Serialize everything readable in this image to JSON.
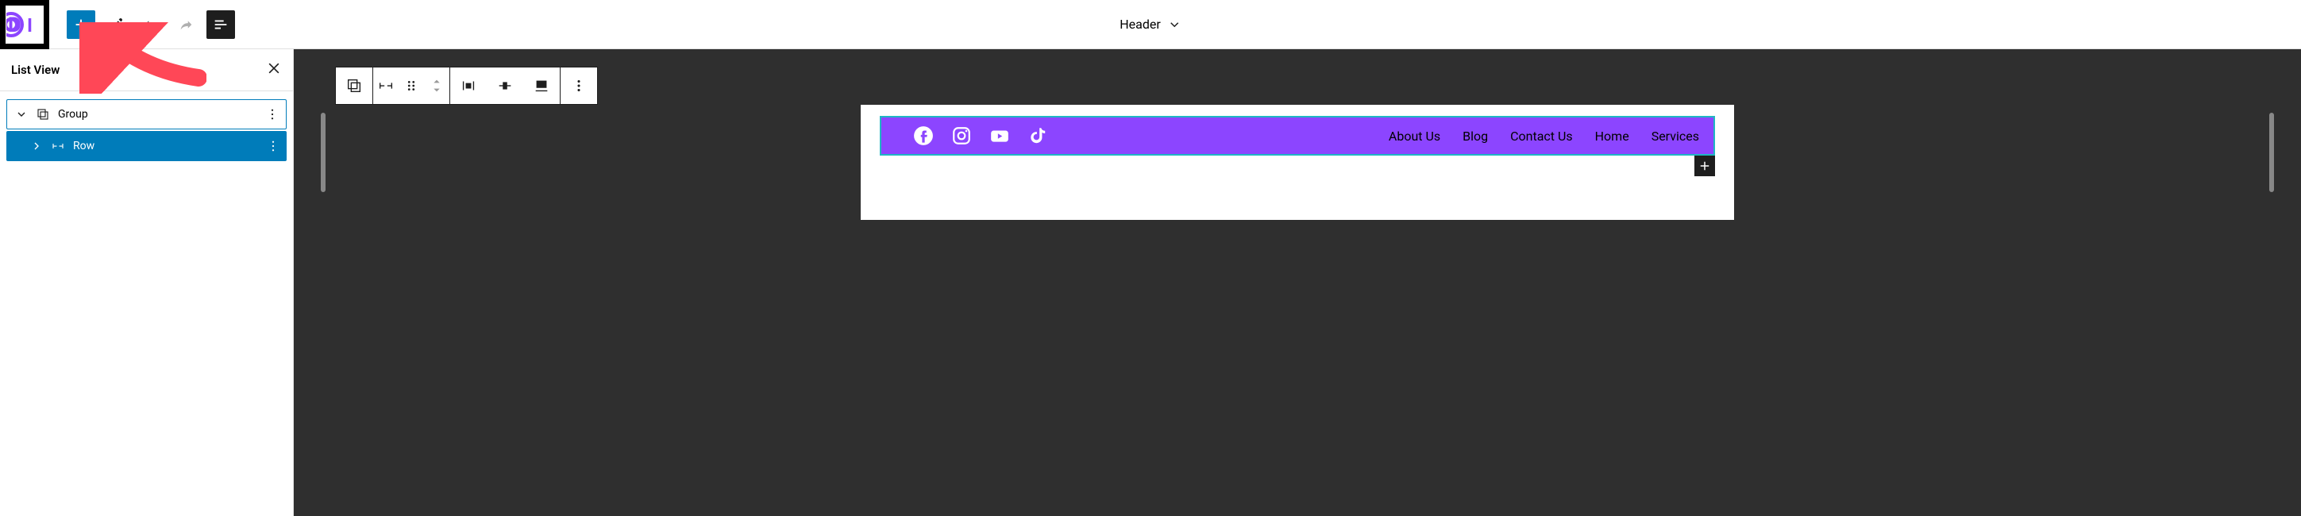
{
  "toolbar": {
    "document_title": "Header"
  },
  "sidebar": {
    "title": "List View",
    "tree": [
      {
        "label": "Group",
        "level": 0,
        "expanded": true,
        "icon": "group"
      },
      {
        "label": "Row",
        "level": 1,
        "expanded": false,
        "icon": "row"
      }
    ]
  },
  "header_block": {
    "nav": [
      "About Us",
      "Blog",
      "Contact Us",
      "Home",
      "Services"
    ],
    "social": [
      "facebook",
      "instagram",
      "youtube",
      "tiktok"
    ],
    "bg_color": "#8c45ff"
  }
}
